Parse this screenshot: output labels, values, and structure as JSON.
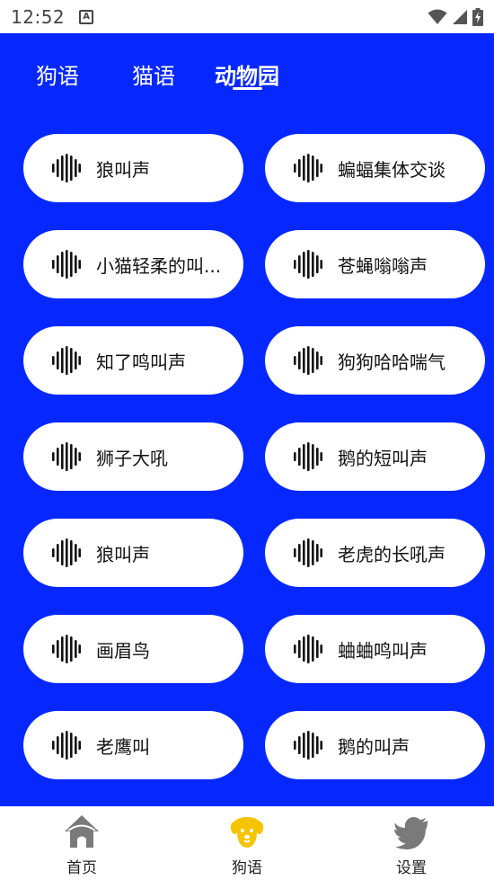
{
  "status_bar": {
    "time": "12:52",
    "notification_icon": "a-box-icon",
    "wifi_icon": "wifi-icon",
    "signal_icon": "cell-signal-icon",
    "battery_icon": "battery-charging-icon"
  },
  "colors": {
    "main_background": "#0628ff",
    "pill_background": "#ffffff",
    "active_nav": "#f5c400",
    "inactive_nav": "#777777"
  },
  "tabs": [
    {
      "label": "狗语",
      "active": false
    },
    {
      "label": "猫语",
      "active": false
    },
    {
      "label": "动物园",
      "active": true
    }
  ],
  "sounds": [
    {
      "label": "狼叫声"
    },
    {
      "label": "蝙蝠集体交谈"
    },
    {
      "label": "小猫轻柔的叫..."
    },
    {
      "label": "苍蝇嗡嗡声"
    },
    {
      "label": "知了鸣叫声"
    },
    {
      "label": "狗狗哈哈喘气"
    },
    {
      "label": "狮子大吼"
    },
    {
      "label": "鹅的短叫声"
    },
    {
      "label": "狼叫声"
    },
    {
      "label": "老虎的长吼声"
    },
    {
      "label": "画眉鸟"
    },
    {
      "label": "蛐蛐鸣叫声"
    },
    {
      "label": "老鹰叫"
    },
    {
      "label": "鹅的叫声"
    }
  ],
  "sound_icon": "sound-wave-icon",
  "bottom_nav": [
    {
      "label": "首页",
      "icon": "home-icon",
      "active": false
    },
    {
      "label": "狗语",
      "icon": "dog-face-icon",
      "active": true
    },
    {
      "label": "设置",
      "icon": "bird-icon",
      "active": false
    }
  ]
}
